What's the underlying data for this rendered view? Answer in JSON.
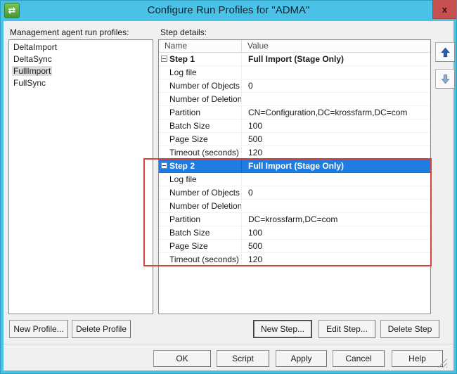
{
  "window": {
    "title": "Configure Run Profiles for \"ADMA\"",
    "icon_glyph": "⇄",
    "close_glyph": "x"
  },
  "colors": {
    "titlebar_cyan": "#4ac1e6",
    "close_button_red": "#c75050",
    "selection_blue": "#1f7de2",
    "annotation_red": "#d8423c",
    "icon_green": "#5aad3d"
  },
  "left_panel": {
    "label": "Management agent run profiles:",
    "profiles": [
      {
        "name": "DeltaImport",
        "selected": false
      },
      {
        "name": "DeltaSync",
        "selected": false
      },
      {
        "name": "FullImport",
        "selected": true
      },
      {
        "name": "FullSync",
        "selected": false
      }
    ],
    "buttons": {
      "new_profile": "New Profile...",
      "delete_profile": "Delete Profile"
    }
  },
  "step_details": {
    "label": "Step details:",
    "columns": {
      "name": "Name",
      "value": "Value"
    },
    "steps": [
      {
        "label": "Step 1",
        "value": "Full Import (Stage Only)",
        "expanded": true,
        "selected": false,
        "properties": [
          {
            "name": "Log file",
            "value": ""
          },
          {
            "name": "Number of Objects",
            "value": "0"
          },
          {
            "name": "Number of Deletions",
            "value": ""
          },
          {
            "name": "Partition",
            "value": "CN=Configuration,DC=krossfarm,DC=com"
          },
          {
            "name": "Batch Size",
            "value": "100"
          },
          {
            "name": "Page Size",
            "value": "500"
          },
          {
            "name": "Timeout (seconds)",
            "value": "120"
          }
        ]
      },
      {
        "label": "Step 2",
        "value": "Full Import (Stage Only)",
        "expanded": true,
        "selected": true,
        "annotated": true,
        "properties": [
          {
            "name": "Log file",
            "value": ""
          },
          {
            "name": "Number of Objects",
            "value": "0"
          },
          {
            "name": "Number of Deletions",
            "value": ""
          },
          {
            "name": "Partition",
            "value": "DC=krossfarm,DC=com"
          },
          {
            "name": "Batch Size",
            "value": "100"
          },
          {
            "name": "Page Size",
            "value": "500"
          },
          {
            "name": "Timeout (seconds)",
            "value": "120"
          }
        ]
      }
    ],
    "buttons": {
      "new_step": "New Step...",
      "edit_step": "Edit Step...",
      "delete_step": "Delete Step"
    }
  },
  "footer": {
    "ok": "OK",
    "script": "Script",
    "apply": "Apply",
    "cancel": "Cancel",
    "help": "Help"
  }
}
